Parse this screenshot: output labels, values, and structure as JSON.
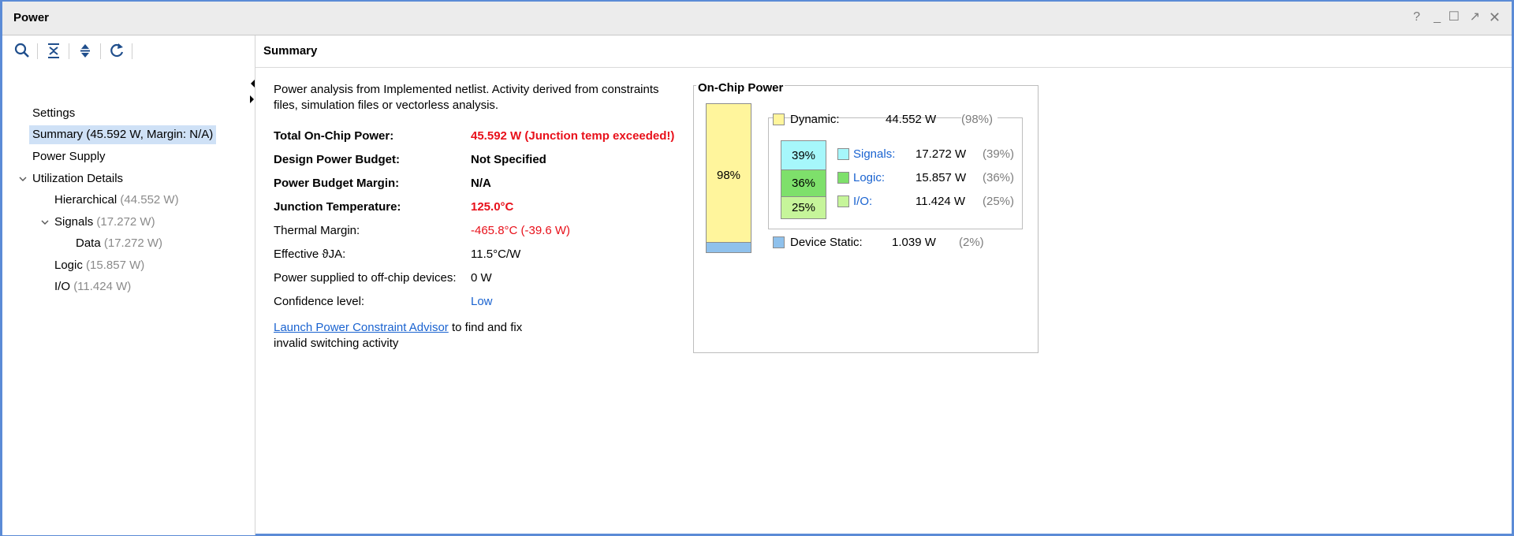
{
  "window": {
    "title": "Power",
    "controls": {
      "help": "?",
      "minimize": "_",
      "maximize": "☐",
      "float": "↗",
      "close": "✕"
    }
  },
  "toolbar": {
    "icons": [
      "search-icon",
      "collapse-all-icon",
      "expand-all-icon",
      "refresh-icon"
    ]
  },
  "tree": {
    "settings": "Settings",
    "summary": "Summary (45.592 W, Margin: N/A)",
    "power_supply": "Power Supply",
    "utilization": "Utilization Details",
    "hierarchical": {
      "label": "Hierarchical",
      "value": "(44.552 W)"
    },
    "signals": {
      "label": "Signals",
      "value": "(17.272 W)"
    },
    "data": {
      "label": "Data",
      "value": "(17.272 W)"
    },
    "logic": {
      "label": "Logic",
      "value": "(15.857 W)"
    },
    "io": {
      "label": "I/O",
      "value": "(11.424 W)"
    }
  },
  "summary": {
    "header": "Summary",
    "description": "Power analysis from Implemented netlist. Activity derived from constraints files, simulation files or vectorless analysis.",
    "rows": [
      {
        "label": "Total On-Chip Power:",
        "value": "45.592 W (Junction temp exceeded!)"
      },
      {
        "label": "Design Power Budget:",
        "value": "Not Specified"
      },
      {
        "label": "Power Budget Margin:",
        "value": "N/A"
      },
      {
        "label": "Junction Temperature:",
        "value": "125.0°C"
      },
      {
        "label": "Thermal Margin:",
        "value": "-465.8°C (-39.6 W)"
      },
      {
        "label": "Effective ϑJA:",
        "value": "11.5°C/W"
      },
      {
        "label": "Power supplied to off-chip devices:",
        "value": "0 W"
      },
      {
        "label": "Confidence level:",
        "value": "Low"
      }
    ],
    "advisor_link": "Launch Power Constraint Advisor",
    "advisor_text_1": "to find and fix",
    "advisor_text_2": "invalid switching activity"
  },
  "onchip": {
    "title": "On-Chip Power",
    "dynamic_pct_bar": "98%",
    "dynamic": {
      "label": "Dynamic:",
      "watts": "44.552 W",
      "pct": "(98%)"
    },
    "signals": {
      "label": "Signals:",
      "watts": "17.272 W",
      "pct": "(39%)",
      "bar": "39%"
    },
    "logic": {
      "label": "Logic:",
      "watts": "15.857 W",
      "pct": "(36%)",
      "bar": "36%"
    },
    "io": {
      "label": "I/O:",
      "watts": "11.424 W",
      "pct": "(25%)",
      "bar": "25%"
    },
    "static": {
      "label": "Device Static:",
      "watts": "1.039 W",
      "pct": "(2%)"
    },
    "colors": {
      "dynamic": "#fff59c",
      "static": "#8fc1ec",
      "signals": "#a6f7fb",
      "logic": "#7ee06b",
      "io": "#c6f59a"
    }
  }
}
